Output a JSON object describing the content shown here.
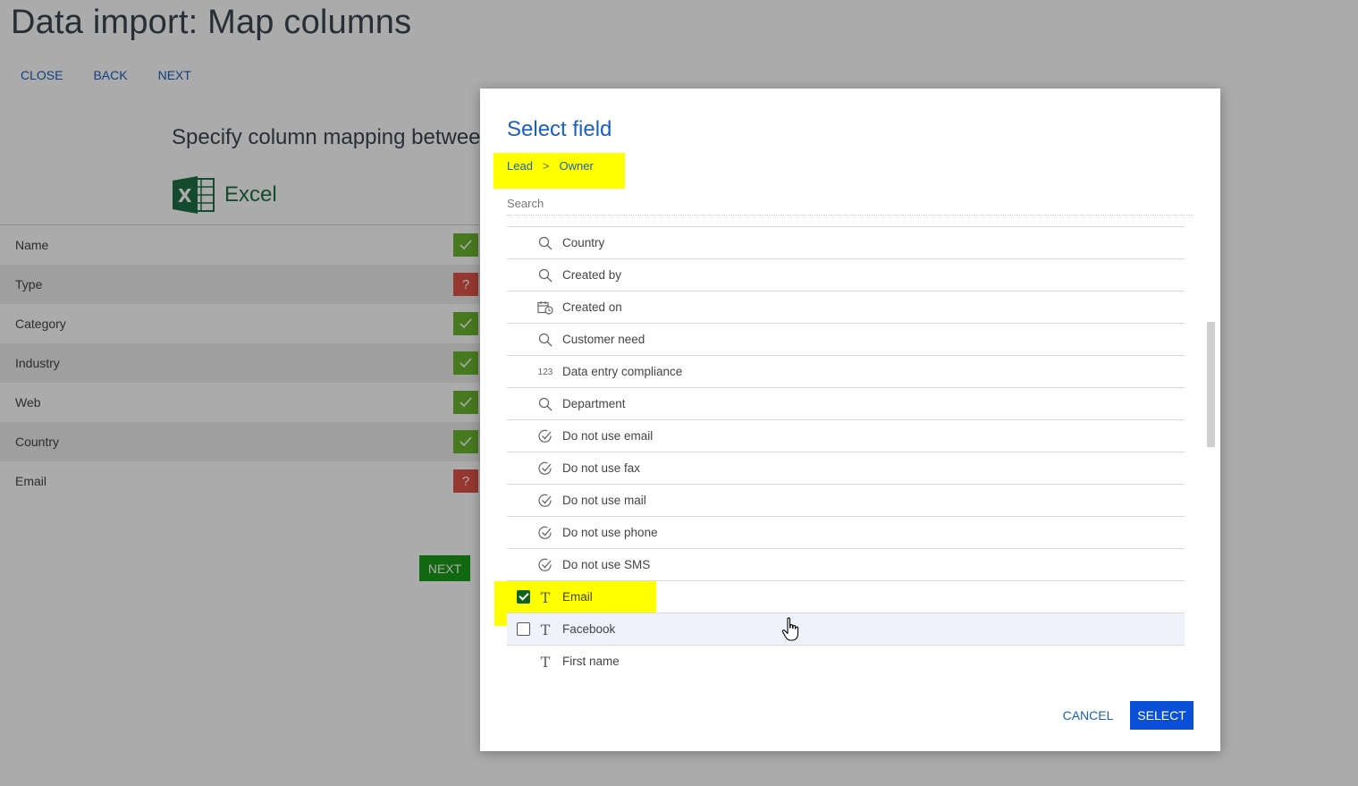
{
  "page": {
    "title": "Data import: Map columns",
    "actions": [
      "CLOSE",
      "BACK",
      "NEXT"
    ],
    "subtitle": "Specify column mapping between",
    "source_label": "Excel",
    "rows": [
      {
        "label": "Name",
        "status": "ok",
        "status_icon": "check-icon"
      },
      {
        "label": "Type",
        "status": "unmapped",
        "status_icon": "question-icon",
        "status_text": "?"
      },
      {
        "label": "Category",
        "status": "ok",
        "status_icon": "check-icon"
      },
      {
        "label": "Industry",
        "status": "ok",
        "status_icon": "check-icon"
      },
      {
        "label": "Web",
        "status": "ok",
        "status_icon": "check-icon"
      },
      {
        "label": "Country",
        "status": "ok",
        "status_icon": "check-icon"
      },
      {
        "label": "Email",
        "status": "unmapped",
        "status_icon": "question-icon",
        "status_text": "?"
      }
    ],
    "next_label": "NEXT"
  },
  "modal": {
    "title": "Select field",
    "breadcrumb": [
      "Lead",
      "Owner"
    ],
    "breadcrumb_separator": ">",
    "search_placeholder": "Search",
    "fields": [
      {
        "label": "Country",
        "icon": "lookup-search-icon"
      },
      {
        "label": "Created by",
        "icon": "lookup-search-icon"
      },
      {
        "label": "Created on",
        "icon": "datetime-icon"
      },
      {
        "label": "Customer need",
        "icon": "lookup-search-icon"
      },
      {
        "label": "Data entry compliance",
        "icon": "number-icon",
        "icon_text": "123"
      },
      {
        "label": "Department",
        "icon": "lookup-search-icon"
      },
      {
        "label": "Do not use email",
        "icon": "boolean-check-icon"
      },
      {
        "label": "Do not use fax",
        "icon": "boolean-check-icon"
      },
      {
        "label": "Do not use mail",
        "icon": "boolean-check-icon"
      },
      {
        "label": "Do not use phone",
        "icon": "boolean-check-icon"
      },
      {
        "label": "Do not use SMS",
        "icon": "boolean-check-icon"
      },
      {
        "label": "Email",
        "icon": "text-type-icon",
        "icon_text": "T",
        "checkbox": "checked"
      },
      {
        "label": "Facebook",
        "icon": "text-type-icon",
        "icon_text": "T",
        "checkbox": "unchecked",
        "hover": true
      },
      {
        "label": "First name",
        "icon": "text-type-icon",
        "icon_text": "T"
      }
    ],
    "cancel_label": "CANCEL",
    "select_label": "SELECT"
  },
  "colors": {
    "accent_blue": "#1b5fbf",
    "select_button": "#0a4fd6",
    "ok_green": "#6bb52e",
    "unmapped_red": "#e0534a",
    "next_green": "#1a9b1a",
    "highlight_yellow": "#ffff00",
    "checkbox_green": "#12621f"
  }
}
